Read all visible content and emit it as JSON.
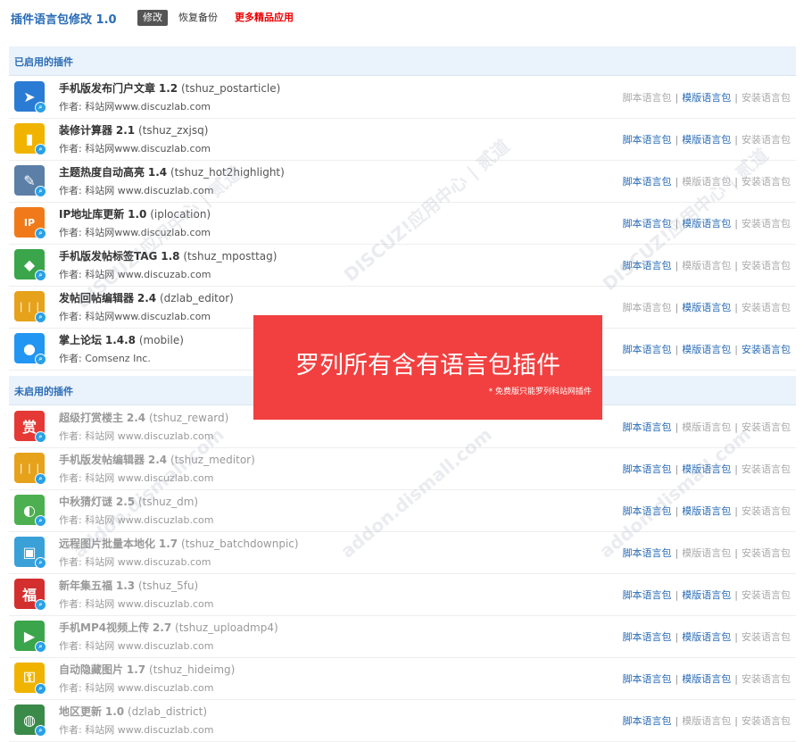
{
  "header": {
    "title": "插件语言包修改 1.0",
    "edit_button": "修改",
    "restore_button": "恢复备份",
    "more_apps_link": "更多精品应用"
  },
  "sections": {
    "enabled": "已启用的插件",
    "disabled": "未启用的插件"
  },
  "actions": {
    "script_pack": "脚本语言包",
    "template_pack": "模版语言包",
    "install_pack": "安装语言包",
    "separator": "|"
  },
  "colors": {
    "link_active": "#2a6cb6",
    "link_disabled": "#aaaaaa",
    "section_bg": "#eaf2fb",
    "overlay_red": "#f24040",
    "more_apps": "#e00000"
  },
  "enabled_plugins": [
    {
      "name": "手机版发布门户文章",
      "version": "1.2",
      "code": "(tshuz_postarticle)",
      "author": "作者: 科站网www.discuzlab.com",
      "icon": "paper-plane-icon",
      "icon_color": "#2a7bd4",
      "script_active": false,
      "template_active": true,
      "install_active": false
    },
    {
      "name": "装修计算器",
      "version": "2.1",
      "code": "(tshuz_zxjsq)",
      "author": "作者: 科站网www.discuzlab.com",
      "icon": "paint-roller-icon",
      "icon_color": "#f0b400",
      "script_active": true,
      "template_active": true,
      "install_active": false
    },
    {
      "name": "主题热度自动高亮",
      "version": "1.4",
      "code": "(tshuz_hot2highlight)",
      "author": "作者: 科站网 www.discuzlab.com",
      "icon": "highlighter-icon",
      "icon_color": "#5b7fa6",
      "script_active": true,
      "template_active": false,
      "install_active": false
    },
    {
      "name": "IP地址库更新",
      "version": "1.0",
      "code": "(iplocation)",
      "author": "作者: 科站网www.discuzlab.com",
      "icon": "ip-pin-icon",
      "icon_color": "#f07a1a",
      "script_active": true,
      "template_active": true,
      "install_active": false
    },
    {
      "name": "手机版发帖标签TAG",
      "version": "1.8",
      "code": "(tshuz_mposttag)",
      "author": "作者: 科站网 www.discuzab.com",
      "icon": "tag-icon",
      "icon_color": "#3aa54a",
      "script_active": true,
      "template_active": false,
      "install_active": false
    },
    {
      "name": "发帖回帖编辑器",
      "version": "2.4",
      "code": "(dzlab_editor)",
      "author": "作者: 科站网www.discuzlab.com",
      "icon": "color-pens-icon",
      "icon_color": "#e6a21a",
      "script_active": false,
      "template_active": true,
      "install_active": false
    },
    {
      "name": "掌上论坛",
      "version": "1.4.8",
      "code": "(mobile)",
      "author": "作者: Comsenz Inc.",
      "icon": "chat-bubble-icon",
      "icon_color": "#2196f3",
      "script_active": true,
      "template_active": true,
      "install_active": true
    }
  ],
  "disabled_plugins": [
    {
      "name": "超级打赏楼主",
      "version": "2.4",
      "code": "(tshuz_reward)",
      "author": "作者: 科站网 www.discuzlab.com",
      "icon": "reward-icon",
      "icon_color": "#e53935",
      "script_active": true,
      "template_active": false,
      "install_active": false
    },
    {
      "name": "手机版发帖编辑器",
      "version": "2.4",
      "code": "(tshuz_meditor)",
      "author": "作者: 科站网 www.discuzlab.com",
      "icon": "color-pens-icon",
      "icon_color": "#e6a21a",
      "script_active": true,
      "template_active": true,
      "install_active": false
    },
    {
      "name": "中秋猜灯谜",
      "version": "2.5",
      "code": "(tshuz_dm)",
      "author": "作者: 科站网 www.discuzlab.com",
      "icon": "lantern-icon",
      "icon_color": "#4caf50",
      "script_active": true,
      "template_active": true,
      "install_active": false
    },
    {
      "name": "远程图片批量本地化",
      "version": "1.7",
      "code": "(tshuz_batchdownpic)",
      "author": "作者: 科站网 www.discuzab.com",
      "icon": "image-icon",
      "icon_color": "#3aa0d8",
      "script_active": true,
      "template_active": false,
      "install_active": false
    },
    {
      "name": "新年集五福",
      "version": "1.3",
      "code": "(tshuz_5fu)",
      "author": "作者: 科站网 www.discuzlab.com",
      "icon": "fortune-icon",
      "icon_color": "#d32f2f",
      "script_active": true,
      "template_active": true,
      "install_active": false
    },
    {
      "name": "手机MP4视频上传",
      "version": "2.7",
      "code": "(tshuz_uploadmp4)",
      "author": "作者: 科站网 www.discuzlab.com",
      "icon": "video-icon",
      "icon_color": "#3aa54a",
      "script_active": true,
      "template_active": true,
      "install_active": false
    },
    {
      "name": "自动隐藏图片",
      "version": "1.7",
      "code": "(tshuz_hideimg)",
      "author": "作者: 科站网 www.discuzlab.com",
      "icon": "key-user-icon",
      "icon_color": "#f0b400",
      "script_active": true,
      "template_active": true,
      "install_active": false
    },
    {
      "name": "地区更新",
      "version": "1.0",
      "code": "(dzlab_district)",
      "author": "作者: 科站网 www.discuzlab.com",
      "icon": "globe-icon",
      "icon_color": "#3a8a4a",
      "script_active": true,
      "template_active": false,
      "install_active": false
    }
  ],
  "overlay": {
    "headline": "罗列所有含有语言包插件",
    "note": "* 免费版只能罗列科站网插件"
  },
  "watermark": {
    "text": "DISCUZ!应用中心 | 贰道",
    "subtext": "addon.dismall.com"
  }
}
